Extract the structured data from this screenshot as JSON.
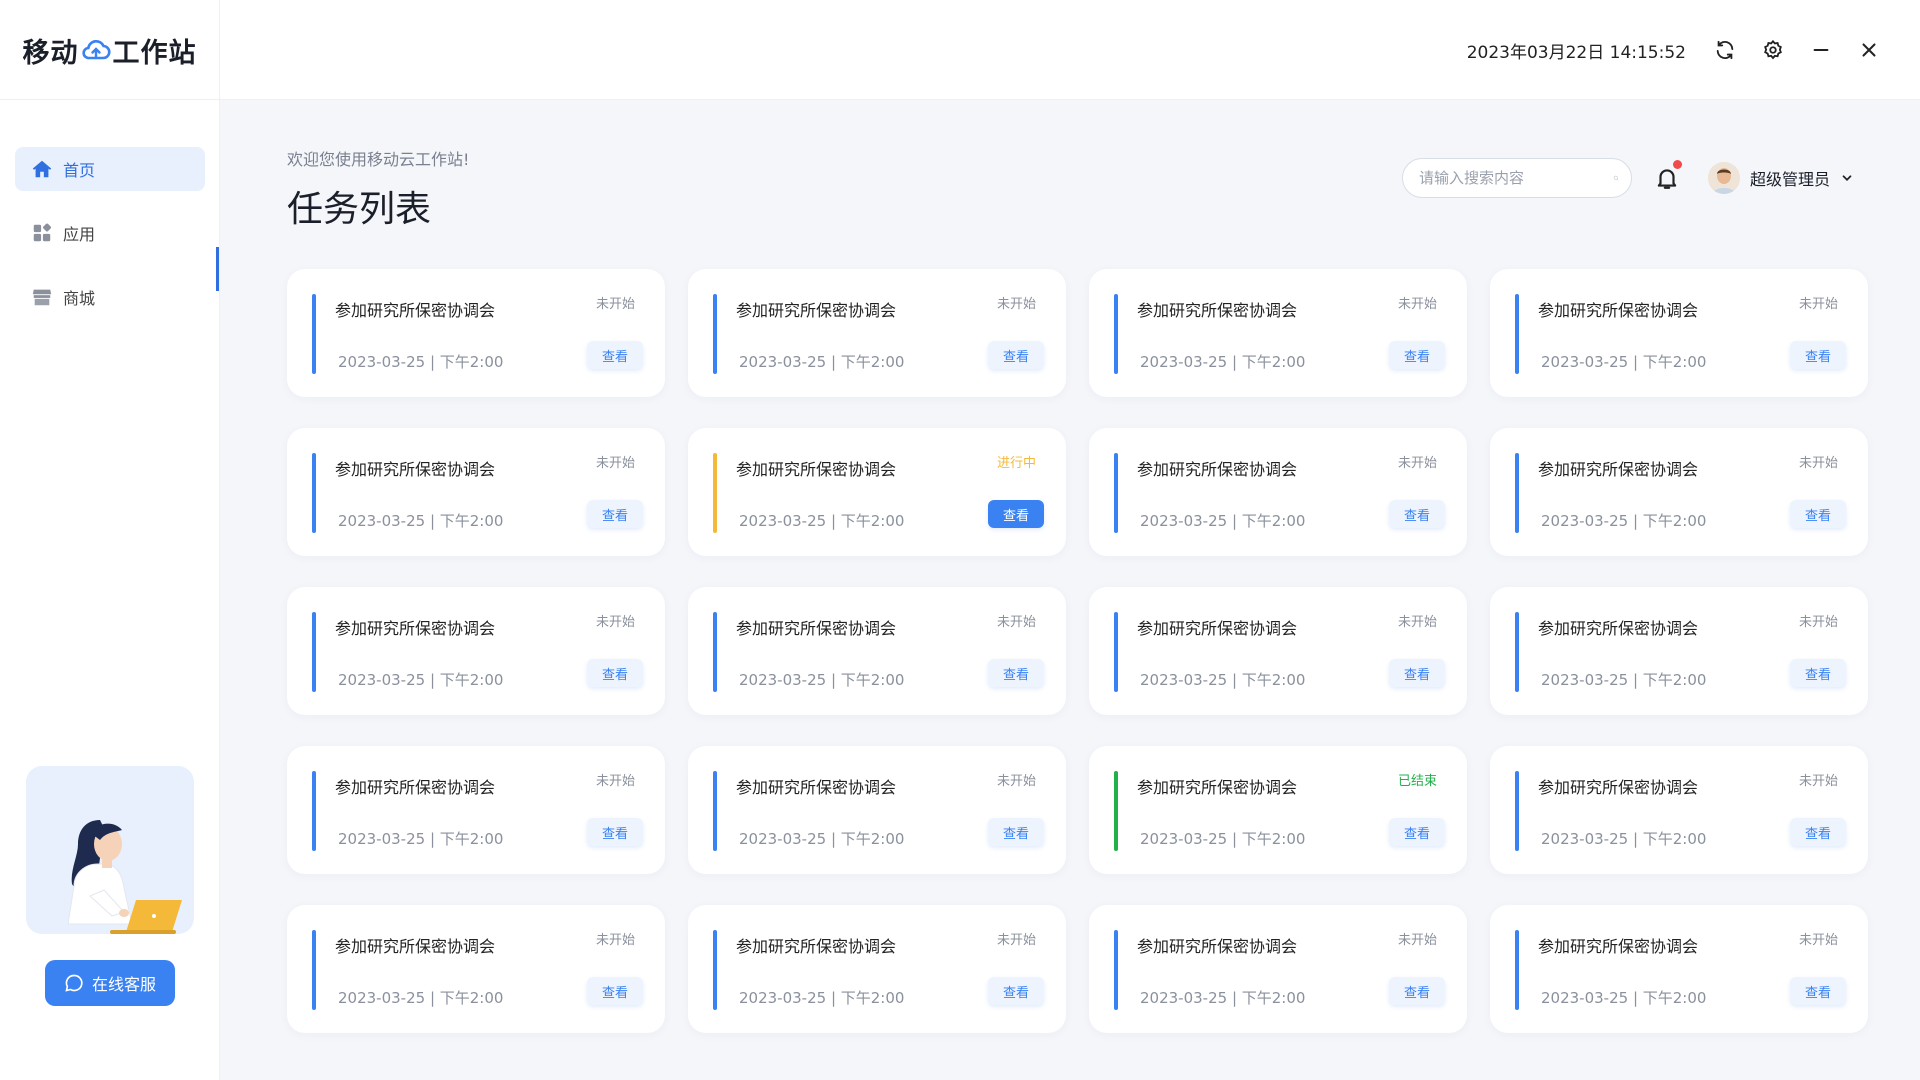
{
  "app": {
    "logo_left": "移动",
    "logo_right": "工作站",
    "datetime": "2023年03月22日 14:15:52"
  },
  "sidebar": {
    "items": [
      {
        "label": "首页",
        "icon": "home-icon",
        "active": true
      },
      {
        "label": "应用",
        "icon": "apps-icon",
        "active": false
      },
      {
        "label": "商城",
        "icon": "store-icon",
        "active": false
      }
    ],
    "support_label": "在线客服"
  },
  "main": {
    "welcome": "欢迎您使用移动云工作站!",
    "title": "任务列表",
    "search_placeholder": "请输入搜索内容",
    "user_name": "超级管理员"
  },
  "colors": {
    "accent": "#3a82f2",
    "in_progress": "#f5b93a",
    "done": "#22b04b"
  },
  "tasks": [
    {
      "title": "参加研究所保密协调会",
      "date": "2023-03-25 | 下午2:00",
      "status": "未开始",
      "state": "pending",
      "action": "查看"
    },
    {
      "title": "参加研究所保密协调会",
      "date": "2023-03-25 | 下午2:00",
      "status": "未开始",
      "state": "pending",
      "action": "查看"
    },
    {
      "title": "参加研究所保密协调会",
      "date": "2023-03-25 | 下午2:00",
      "status": "未开始",
      "state": "pending",
      "action": "查看"
    },
    {
      "title": "参加研究所保密协调会",
      "date": "2023-03-25 | 下午2:00",
      "status": "未开始",
      "state": "pending",
      "action": "查看"
    },
    {
      "title": "参加研究所保密协调会",
      "date": "2023-03-25 | 下午2:00",
      "status": "未开始",
      "state": "pending",
      "action": "查看"
    },
    {
      "title": "参加研究所保密协调会",
      "date": "2023-03-25 | 下午2:00",
      "status": "进行中",
      "state": "progress",
      "action": "查看"
    },
    {
      "title": "参加研究所保密协调会",
      "date": "2023-03-25 | 下午2:00",
      "status": "未开始",
      "state": "pending",
      "action": "查看"
    },
    {
      "title": "参加研究所保密协调会",
      "date": "2023-03-25 | 下午2:00",
      "status": "未开始",
      "state": "pending",
      "action": "查看"
    },
    {
      "title": "参加研究所保密协调会",
      "date": "2023-03-25 | 下午2:00",
      "status": "未开始",
      "state": "pending",
      "action": "查看"
    },
    {
      "title": "参加研究所保密协调会",
      "date": "2023-03-25 | 下午2:00",
      "status": "未开始",
      "state": "pending",
      "action": "查看"
    },
    {
      "title": "参加研究所保密协调会",
      "date": "2023-03-25 | 下午2:00",
      "status": "未开始",
      "state": "pending",
      "action": "查看"
    },
    {
      "title": "参加研究所保密协调会",
      "date": "2023-03-25 | 下午2:00",
      "status": "未开始",
      "state": "pending",
      "action": "查看"
    },
    {
      "title": "参加研究所保密协调会",
      "date": "2023-03-25 | 下午2:00",
      "status": "未开始",
      "state": "pending",
      "action": "查看"
    },
    {
      "title": "参加研究所保密协调会",
      "date": "2023-03-25 | 下午2:00",
      "status": "未开始",
      "state": "pending",
      "action": "查看"
    },
    {
      "title": "参加研究所保密协调会",
      "date": "2023-03-25 | 下午2:00",
      "status": "已结束",
      "state": "done",
      "action": "查看"
    },
    {
      "title": "参加研究所保密协调会",
      "date": "2023-03-25 | 下午2:00",
      "status": "未开始",
      "state": "pending",
      "action": "查看"
    },
    {
      "title": "参加研究所保密协调会",
      "date": "2023-03-25 | 下午2:00",
      "status": "未开始",
      "state": "pending",
      "action": "查看"
    },
    {
      "title": "参加研究所保密协调会",
      "date": "2023-03-25 | 下午2:00",
      "status": "未开始",
      "state": "pending",
      "action": "查看"
    },
    {
      "title": "参加研究所保密协调会",
      "date": "2023-03-25 | 下午2:00",
      "status": "未开始",
      "state": "pending",
      "action": "查看"
    },
    {
      "title": "参加研究所保密协调会",
      "date": "2023-03-25 | 下午2:00",
      "status": "未开始",
      "state": "pending",
      "action": "查看"
    }
  ]
}
